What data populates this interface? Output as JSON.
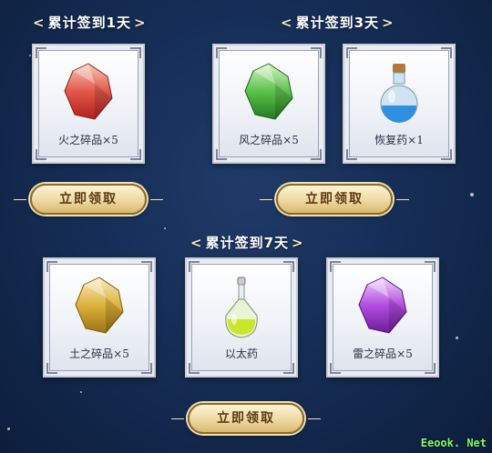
{
  "sections": [
    {
      "title": "累计签到1天",
      "items": [
        {
          "label": "火之碎品×5",
          "icon": "fire-crystal-icon"
        }
      ],
      "button": "立即领取"
    },
    {
      "title": "累计签到3天",
      "items": [
        {
          "label": "风之碎品×5",
          "icon": "wind-crystal-icon"
        },
        {
          "label": "恢复药×1",
          "icon": "healing-potion-icon"
        }
      ],
      "button": "立即领取"
    },
    {
      "title": "累计签到7天",
      "items": [
        {
          "label": "土之碎品×5",
          "icon": "earth-crystal-icon"
        },
        {
          "label": "以太药",
          "icon": "ether-potion-icon"
        },
        {
          "label": "雷之碎品×5",
          "icon": "thunder-crystal-icon"
        }
      ],
      "button": "立即领取"
    }
  ],
  "watermark": "Eeook. Net",
  "colors": {
    "background": "#142b52",
    "button_text": "#5b3a12",
    "fire": "#d9442e",
    "wind": "#3fae3a",
    "earth": "#c9a126",
    "thunder": "#a03bd1",
    "potion_blue": "#2f8fe0",
    "potion_green": "#c8e62a"
  }
}
